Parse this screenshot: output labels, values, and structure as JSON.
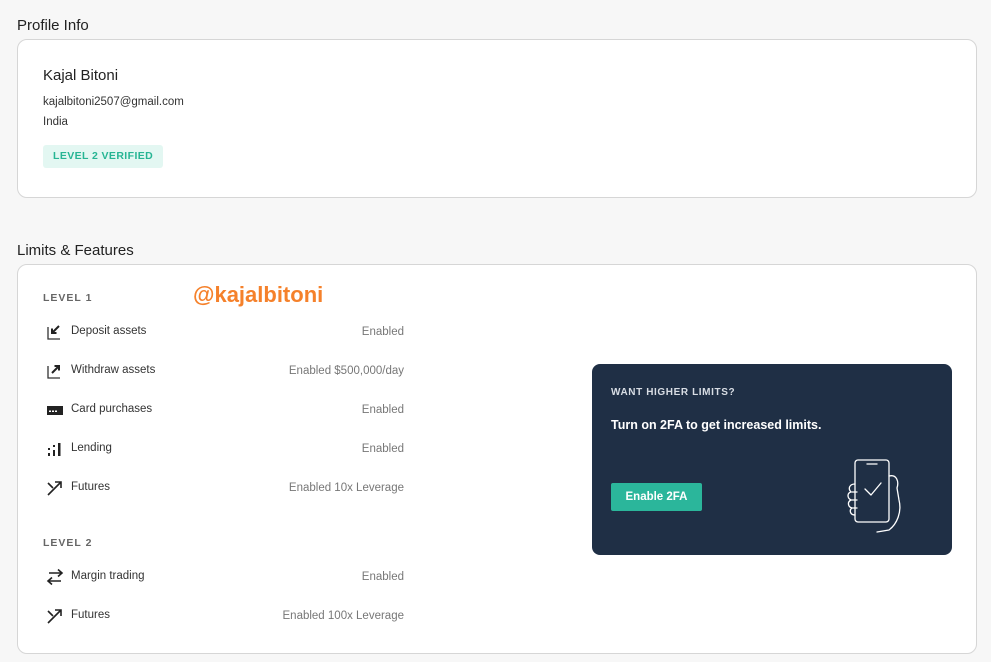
{
  "profile": {
    "section_title": "Profile Info",
    "name": "Kajal Bitoni",
    "email": "kajalbitoni2507@gmail.com",
    "country": "India",
    "badge": "LEVEL 2 VERIFIED"
  },
  "limits": {
    "section_title": "Limits & Features",
    "watermark": "@kajalbitoni",
    "level1": {
      "label": "LEVEL 1",
      "features": [
        {
          "icon": "deposit-arrow-icon",
          "name": "Deposit assets",
          "status": "Enabled"
        },
        {
          "icon": "withdraw-arrow-icon",
          "name": "Withdraw assets",
          "status": "Enabled $500,000/day"
        },
        {
          "icon": "card-icon",
          "name": "Card purchases",
          "status": "Enabled"
        },
        {
          "icon": "lending-bars-icon",
          "name": "Lending",
          "status": "Enabled"
        },
        {
          "icon": "futures-arrows-icon",
          "name": "Futures",
          "status": "Enabled 10x Leverage"
        }
      ]
    },
    "level2": {
      "label": "LEVEL 2",
      "features": [
        {
          "icon": "swap-arrows-icon",
          "name": "Margin trading",
          "status": "Enabled"
        },
        {
          "icon": "futures-arrows-icon",
          "name": "Futures",
          "status": "Enabled 100x Leverage"
        }
      ]
    },
    "promo": {
      "kicker": "WANT HIGHER LIMITS?",
      "title": "Turn on 2FA to get increased limits.",
      "button": "Enable 2FA",
      "illustration": "phone-in-hand-check-icon"
    }
  },
  "colors": {
    "page_bg": "#f7f7f7",
    "badge_bg": "#e3f7f2",
    "badge_text": "#27b594",
    "promo_bg": "#1f2f45",
    "button": "#2bb69b",
    "watermark": "#f5812b"
  }
}
